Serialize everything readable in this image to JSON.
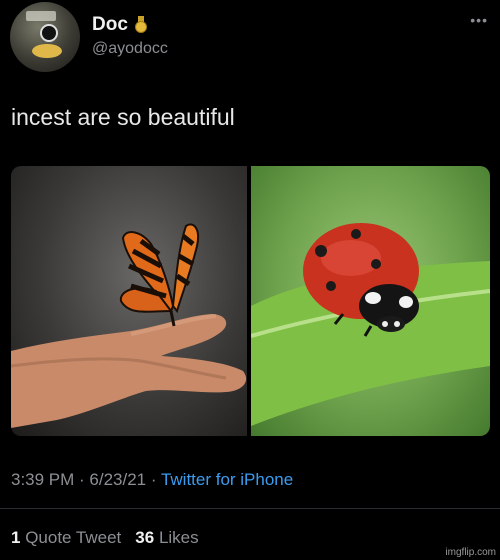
{
  "user": {
    "display_name": "Doc",
    "handle": "@ayodocc"
  },
  "tweet": {
    "text": "incest are so beautiful",
    "time": "3:39 PM · 6/23/21 · ",
    "source": "Twitter for iPhone"
  },
  "stats": {
    "quote_count": "1",
    "quote_label": "Quote Tweet",
    "likes_count": "36",
    "likes_label": "Likes"
  },
  "watermark": "imgflip.com",
  "icons": {
    "avatar": "avatar-image",
    "verified": "medal-icon",
    "more": "more-icon"
  },
  "colors": {
    "background": "#000000",
    "link": "#3b9cf0",
    "muted": "#8b8f94"
  }
}
